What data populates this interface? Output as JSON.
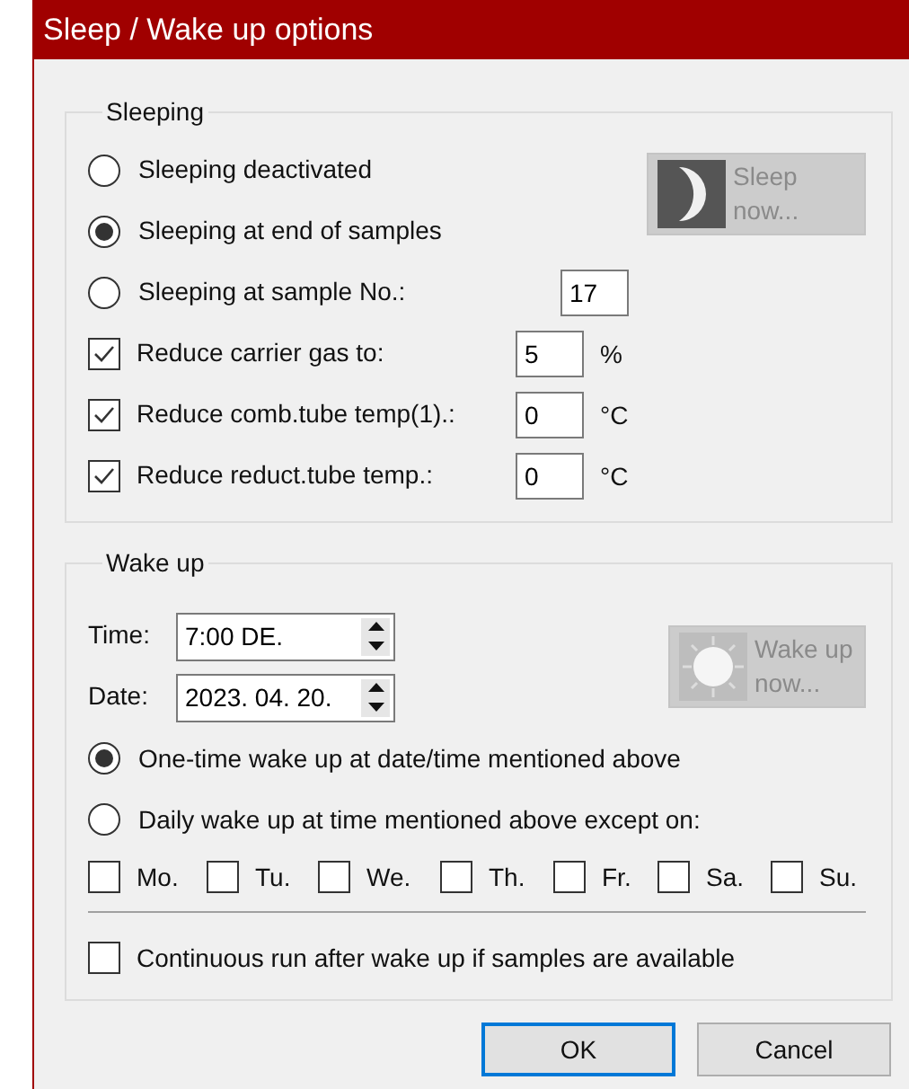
{
  "window": {
    "title": "Sleep / Wake up options"
  },
  "sleeping": {
    "title": "Sleeping",
    "radios": [
      {
        "label": "Sleeping deactivated",
        "selected": false
      },
      {
        "label": "Sleeping at end of samples",
        "selected": true
      },
      {
        "label": "Sleeping at sample No.:",
        "selected": false,
        "value": "17"
      }
    ],
    "reductions": [
      {
        "label": "Reduce carrier gas to:",
        "checked": true,
        "value": "5",
        "unit": "%"
      },
      {
        "label": "Reduce comb.tube temp(1).:",
        "checked": true,
        "value": "0",
        "unit": "°C"
      },
      {
        "label": "Reduce reduct.tube temp.:",
        "checked": true,
        "value": "0",
        "unit": "°C"
      }
    ],
    "button": {
      "label": "Sleep now...",
      "disabled": true
    }
  },
  "wake_up": {
    "title": "Wake up",
    "time": {
      "label": "Time:",
      "value": "7:00 DE."
    },
    "date": {
      "label": "Date:",
      "value": "2023. 04. 20."
    },
    "button": {
      "label": "Wake up now...",
      "disabled": true
    },
    "radios": [
      {
        "label": "One-time wake up at date/time mentioned above",
        "selected": true
      },
      {
        "label": "Daily wake up at time mentioned above except on:",
        "selected": false
      }
    ],
    "days": [
      {
        "label": "Mo.",
        "checked": false
      },
      {
        "label": "Tu.",
        "checked": false
      },
      {
        "label": "We.",
        "checked": false
      },
      {
        "label": "Th.",
        "checked": false
      },
      {
        "label": "Fr.",
        "checked": false
      },
      {
        "label": "Sa.",
        "checked": false
      },
      {
        "label": "Su.",
        "checked": false
      }
    ],
    "continuous": {
      "label": "Continuous run after wake up if samples are available",
      "checked": false
    }
  },
  "buttons": [
    {
      "label": "OK",
      "focused": true
    },
    {
      "label": "Cancel",
      "focused": false
    }
  ]
}
